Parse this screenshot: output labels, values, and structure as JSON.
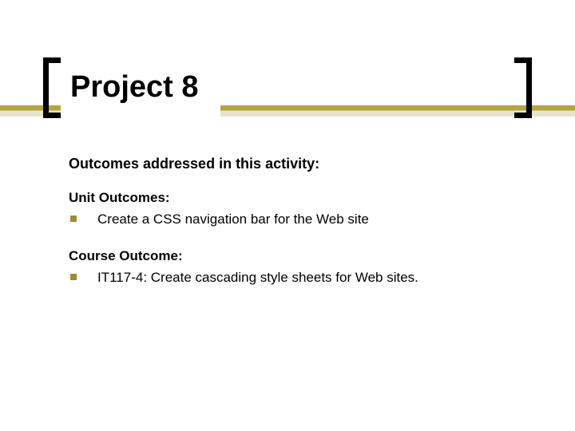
{
  "title": "Project 8",
  "section_heading": "Outcomes addressed in this activity:",
  "subsections": [
    {
      "heading": "Unit Outcomes:",
      "items": [
        "Create a CSS navigation bar for the Web site"
      ]
    },
    {
      "heading": "Course Outcome:",
      "items": [
        "IT117-4: Create cascading style sheets for Web sites."
      ]
    }
  ]
}
